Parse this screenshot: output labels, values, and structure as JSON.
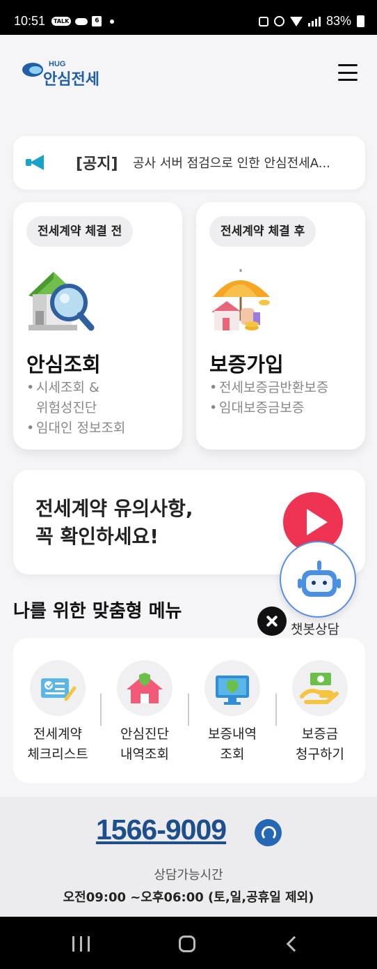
{
  "status_bar": {
    "time": "10:51",
    "talk_badge": "TALK",
    "calendar_day": "6",
    "battery": "83%"
  },
  "header": {
    "logo_small": "HUG",
    "logo_text": "안심전세"
  },
  "notice": {
    "tag": "[공지]",
    "text": "공사 서버 점검으로 인한 안심전세A..."
  },
  "cards": [
    {
      "tag": "전세계약 체결 전",
      "title": "안심조회",
      "bullets": [
        "시세조회 &",
        "위험성진단",
        "임대인 정보조회"
      ],
      "icon": "house-search-icon"
    },
    {
      "tag": "전세계약 체결 후",
      "title": "보증가입",
      "bullets": [
        "전세보증금반환보증",
        "임대보증금보증"
      ],
      "icon": "umbrella-house-icon"
    }
  ],
  "caution": {
    "line1": "전세계약 유의사항,",
    "line2": "꼭 확인하세요!"
  },
  "chatbot": {
    "label": "챗봇상담"
  },
  "custom_menu": {
    "title": "나를 위한 맞춤형 메뉴",
    "items": [
      {
        "line1": "전세계약",
        "line2": "체크리스트",
        "icon": "checklist-icon"
      },
      {
        "line1": "안심진단",
        "line2": "내역조회",
        "icon": "house-shield-icon"
      },
      {
        "line1": "보증내역",
        "line2": "조회",
        "icon": "monitor-shield-icon"
      },
      {
        "line1": "보증금",
        "line2": "청구하기",
        "icon": "hand-money-icon"
      }
    ]
  },
  "footer": {
    "phone": "1566-9009",
    "hours_label": "상담가능시간",
    "hours": "오전09:00 ~오후06:00 (토,일,공휴일 제외)"
  },
  "colors": {
    "brand_blue": "#1e5fa8",
    "play_red": "#ef3453",
    "notice_icon": "#1aa3c9"
  }
}
